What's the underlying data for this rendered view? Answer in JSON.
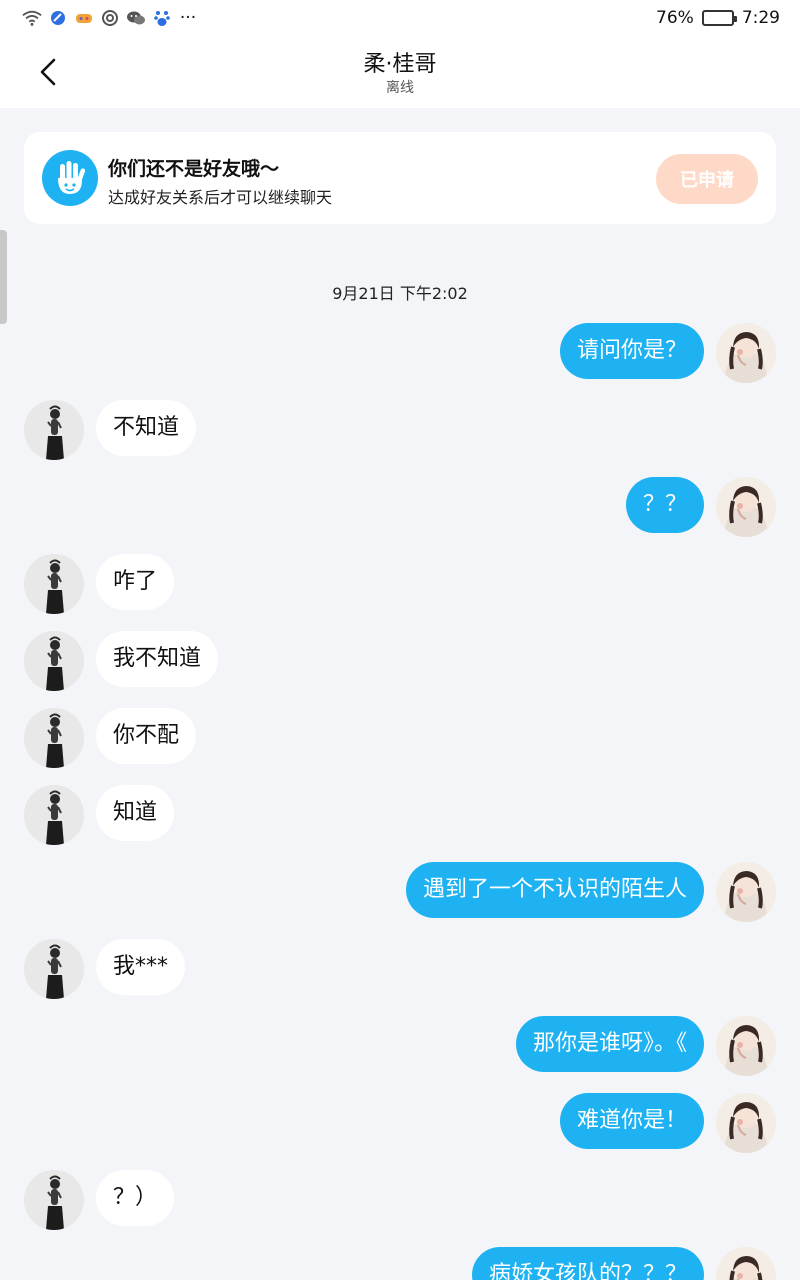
{
  "status_bar": {
    "icons": [
      "wifi-icon",
      "app-icon",
      "game-icon",
      "camera-icon",
      "wechat-icon",
      "baidu-icon",
      "more-icon"
    ],
    "more": "···",
    "battery": "76%",
    "battery_level": 0.76,
    "time": "7:29"
  },
  "header": {
    "title": "柔·桂哥",
    "status": "离线"
  },
  "notice": {
    "title": "你们还不是好友哦～",
    "desc": "达成好友关系后才可以继续聊天",
    "button": "已申请"
  },
  "timestamp": "9月21日 下午2:02",
  "colors": {
    "accent": "#1fb2f2",
    "applied_button": "#ffd9c8",
    "background": "#f3f5f8"
  },
  "messages": [
    {
      "side": "out",
      "text": "请问你是？"
    },
    {
      "side": "in",
      "text": "不知道"
    },
    {
      "side": "out",
      "text": "？？"
    },
    {
      "side": "in",
      "text": "咋了"
    },
    {
      "side": "in",
      "text": "我不知道"
    },
    {
      "side": "in",
      "text": "你不配"
    },
    {
      "side": "in",
      "text": "知道"
    },
    {
      "side": "out",
      "text": "遇到了一个不认识的陌生人"
    },
    {
      "side": "in",
      "text": "我***"
    },
    {
      "side": "out",
      "text": "那你是谁呀》。《"
    },
    {
      "side": "out",
      "text": "难道你是！"
    },
    {
      "side": "in",
      "text": "？）"
    },
    {
      "side": "out",
      "text": "病娇女孩队的？？？"
    }
  ]
}
